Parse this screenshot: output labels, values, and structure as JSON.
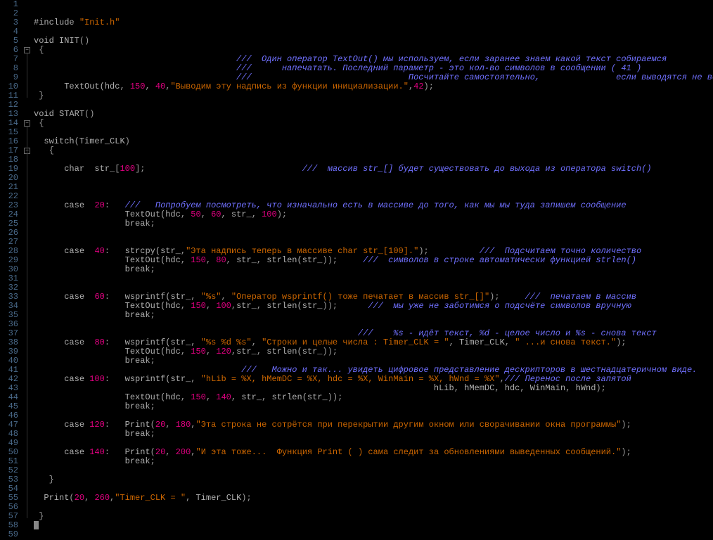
{
  "lines": [
    {
      "n": 1,
      "h": ""
    },
    {
      "n": 2,
      "h": ""
    },
    {
      "n": 3,
      "h": "<span class='preproc'>#include </span><span class='str'>\"Init.h\"</span>"
    },
    {
      "n": 4,
      "h": ""
    },
    {
      "n": 5,
      "h": "<span class='kw'>void</span><span class='id'> INIT</span><span class='punc'>()</span>"
    },
    {
      "n": 6,
      "h": " <span class='punc'>{</span>",
      "fold": "minus"
    },
    {
      "n": 7,
      "h": "                                        <span class='cmt'>///  Один оператор TextOut() мы используем, если заранее знаем какой текст собираемся</span>"
    },
    {
      "n": 8,
      "h": "                                        <span class='cmt'>///      напечатать. Последний параметр - это кол-во символов в сообщении ( 41 )</span>"
    },
    {
      "n": 9,
      "h": "                                        <span class='cmt'>///                               Посчитайте самостоятельно,               если выводятся не все символы.</span>"
    },
    {
      "n": 10,
      "h": "      <span class='id'>TextOut(hdc</span><span class='punc'>, </span><span class='num'>150</span><span class='punc'>, </span><span class='num'>40</span><span class='punc'>,</span><span class='str'>\"Выводим эту надпись из функции инициализации.\"</span><span class='punc'>,</span><span class='num'>42</span><span class='punc'>);</span>"
    },
    {
      "n": 11,
      "h": " <span class='punc'>}</span>"
    },
    {
      "n": 12,
      "h": ""
    },
    {
      "n": 13,
      "h": "<span class='kw'>void</span><span class='id'> START</span><span class='punc'>()</span>"
    },
    {
      "n": 14,
      "h": " <span class='punc'>{</span>",
      "fold": "minus"
    },
    {
      "n": 15,
      "h": ""
    },
    {
      "n": 16,
      "h": "  <span class='kw'>switch</span><span class='punc'>(</span><span class='id'>Timer_CLK</span><span class='punc'>)</span>"
    },
    {
      "n": 17,
      "h": "   <span class='punc'>{</span>",
      "fold": "minus",
      "foldIndent": true
    },
    {
      "n": 18,
      "h": ""
    },
    {
      "n": 19,
      "h": "      <span class='kw'>char</span><span class='id'>  str_</span><span class='punc'>[</span><span class='num'>100</span><span class='punc'>];</span>                               <span class='cmt'>///  массив str_[] будет существовать до выхода из оператора switch()</span>"
    },
    {
      "n": 20,
      "h": ""
    },
    {
      "n": 21,
      "h": ""
    },
    {
      "n": 22,
      "h": ""
    },
    {
      "n": 23,
      "h": "      <span class='kw'>case</span><span class='id'>  </span><span class='num'>20</span><span class='punc'>:</span>   <span class='cmt'>///   Попробуем посмотреть, что изначально есть в массиве до того, как мы мы туда запишем сообщение</span>"
    },
    {
      "n": 24,
      "h": "                  <span class='id'>TextOut(hdc</span><span class='punc'>, </span><span class='num'>50</span><span class='punc'>, </span><span class='num'>60</span><span class='punc'>, </span><span class='id'>str_</span><span class='punc'>, </span><span class='num'>100</span><span class='punc'>);</span>"
    },
    {
      "n": 25,
      "h": "                  <span class='kw'>break</span><span class='punc'>;</span>"
    },
    {
      "n": 26,
      "h": ""
    },
    {
      "n": 27,
      "h": ""
    },
    {
      "n": 28,
      "h": "      <span class='kw'>case</span><span class='id'>  </span><span class='num'>40</span><span class='punc'>:</span>   <span class='id'>strcpy(str_</span><span class='punc'>,</span><span class='str'>\"Эта надпись теперь в массиве char str_[100].\"</span><span class='punc'>);</span>          <span class='cmt'>///  Подсчитаем точно количество</span>"
    },
    {
      "n": 29,
      "h": "                  <span class='id'>TextOut(hdc</span><span class='punc'>, </span><span class='num'>150</span><span class='punc'>, </span><span class='num'>80</span><span class='punc'>, </span><span class='id'>str_</span><span class='punc'>, </span><span class='id'>strlen(str_</span><span class='punc'>));</span>     <span class='cmt'>///  символов в строке автоматически функцией strlen()</span>"
    },
    {
      "n": 30,
      "h": "                  <span class='kw'>break</span><span class='punc'>;</span>"
    },
    {
      "n": 31,
      "h": ""
    },
    {
      "n": 32,
      "h": ""
    },
    {
      "n": 33,
      "h": "      <span class='kw'>case</span><span class='id'>  </span><span class='num'>60</span><span class='punc'>:</span>   <span class='id'>wsprintf(str_</span><span class='punc'>, </span><span class='str'>\"%s\"</span><span class='punc'>, </span><span class='str'>\"Оператор wsprintf() тоже печатает в массив str_[]\"</span><span class='punc'>);</span>     <span class='cmt'>///  печатаем в массив</span>"
    },
    {
      "n": 34,
      "h": "                  <span class='id'>TextOut(hdc</span><span class='punc'>, </span><span class='num'>150</span><span class='punc'>, </span><span class='num'>100</span><span class='punc'>,</span><span class='id'>str_</span><span class='punc'>, </span><span class='id'>strlen(str_</span><span class='punc'>));</span>      <span class='cmt'>///  мы уже не заботимся о подсчёте символов вручную</span>"
    },
    {
      "n": 35,
      "h": "                  <span class='kw'>break</span><span class='punc'>;</span>"
    },
    {
      "n": 36,
      "h": ""
    },
    {
      "n": 37,
      "h": "                                                                <span class='cmt'>///    %s - идёт текст, %d - целое число и %s - снова текст</span>"
    },
    {
      "n": 38,
      "h": "      <span class='kw'>case</span><span class='id'>  </span><span class='num'>80</span><span class='punc'>:</span>   <span class='id'>wsprintf(str_</span><span class='punc'>, </span><span class='str'>\"%s %d %s\"</span><span class='punc'>, </span><span class='str'>\"Строки и целые числа : Timer_CLK = \"</span><span class='punc'>, </span><span class='id'>Timer_CLK</span><span class='punc'>, </span><span class='str'>\" ...и снова текст.\"</span><span class='punc'>);</span>"
    },
    {
      "n": 39,
      "h": "                  <span class='id'>TextOut(hdc</span><span class='punc'>, </span><span class='num'>150</span><span class='punc'>, </span><span class='num'>120</span><span class='punc'>,</span><span class='id'>str_</span><span class='punc'>, </span><span class='id'>strlen(str_</span><span class='punc'>));</span>"
    },
    {
      "n": 40,
      "h": "                  <span class='kw'>break</span><span class='punc'>;</span>"
    },
    {
      "n": 41,
      "h": "                                         <span class='cmt'>///   Можно и так... увидеть цифровое представление дескрипторов в шестнадцатеричном виде.</span>"
    },
    {
      "n": 42,
      "h": "      <span class='kw'>case</span><span class='id'> </span><span class='num'>100</span><span class='punc'>:</span>   <span class='id'>wsprintf(str_</span><span class='punc'>, </span><span class='str'>\"hLib = %X, hMemDC = %X, hdc = %X, WinMain = %X, hWnd = %X\"</span><span class='punc'>,</span><span class='cmt'>/// Перенос после запятой</span>"
    },
    {
      "n": 43,
      "h": "                                                                               <span class='id'>hLib</span><span class='punc'>, </span><span class='id'>hMemDC</span><span class='punc'>, </span><span class='id'>hdc</span><span class='punc'>, </span><span class='id'>WinMain</span><span class='punc'>, </span><span class='id'>hWnd</span><span class='punc'>);</span>"
    },
    {
      "n": 44,
      "h": "                  <span class='id'>TextOut(hdc</span><span class='punc'>, </span><span class='num'>150</span><span class='punc'>, </span><span class='num'>140</span><span class='punc'>, </span><span class='id'>str_</span><span class='punc'>, </span><span class='id'>strlen(str_</span><span class='punc'>));</span>"
    },
    {
      "n": 45,
      "h": "                  <span class='kw'>break</span><span class='punc'>;</span>"
    },
    {
      "n": 46,
      "h": ""
    },
    {
      "n": 47,
      "h": "      <span class='kw'>case</span><span class='id'> </span><span class='num'>120</span><span class='punc'>:</span>   <span class='id'>Print</span><span class='punc'>(</span><span class='num'>20</span><span class='punc'>, </span><span class='num'>180</span><span class='punc'>,</span><span class='str'>\"Эта строка не сотрётся при перекрытии другим окном или сворачивании окна программы\"</span><span class='punc'>);</span>"
    },
    {
      "n": 48,
      "h": "                  <span class='kw'>break</span><span class='punc'>;</span>"
    },
    {
      "n": 49,
      "h": ""
    },
    {
      "n": 50,
      "h": "      <span class='kw'>case</span><span class='id'> </span><span class='num'>140</span><span class='punc'>:</span>   <span class='id'>Print</span><span class='punc'>(</span><span class='num'>20</span><span class='punc'>, </span><span class='num'>200</span><span class='punc'>,</span><span class='str'>\"И эта тоже...  Функция Print ( ) сама следит за обновлениями выведенных сообщений.\"</span><span class='punc'>);</span>"
    },
    {
      "n": 51,
      "h": "                  <span class='kw'>break</span><span class='punc'>;</span>"
    },
    {
      "n": 52,
      "h": ""
    },
    {
      "n": 53,
      "h": "   <span class='punc'>}</span>"
    },
    {
      "n": 54,
      "h": ""
    },
    {
      "n": 55,
      "h": "  <span class='id'>Print</span><span class='punc'>(</span><span class='num'>20</span><span class='punc'>, </span><span class='num'>260</span><span class='punc'>,</span><span class='str'>\"Timer_CLK = \"</span><span class='punc'>, </span><span class='id'>Timer_CLK</span><span class='punc'>);</span>"
    },
    {
      "n": 56,
      "h": ""
    },
    {
      "n": 57,
      "h": " <span class='punc'>}</span>"
    },
    {
      "n": 58,
      "h": "<span class='cursor'></span>"
    },
    {
      "n": 59,
      "h": ""
    }
  ],
  "foldMarkers": [
    {
      "line": 6,
      "type": "minus"
    },
    {
      "line": 14,
      "type": "minus"
    },
    {
      "line": 17,
      "type": "minus"
    }
  ],
  "foldLines": [
    {
      "from": 6,
      "to": 11
    },
    {
      "from": 14,
      "to": 57
    },
    {
      "from": 17,
      "to": 53
    }
  ]
}
